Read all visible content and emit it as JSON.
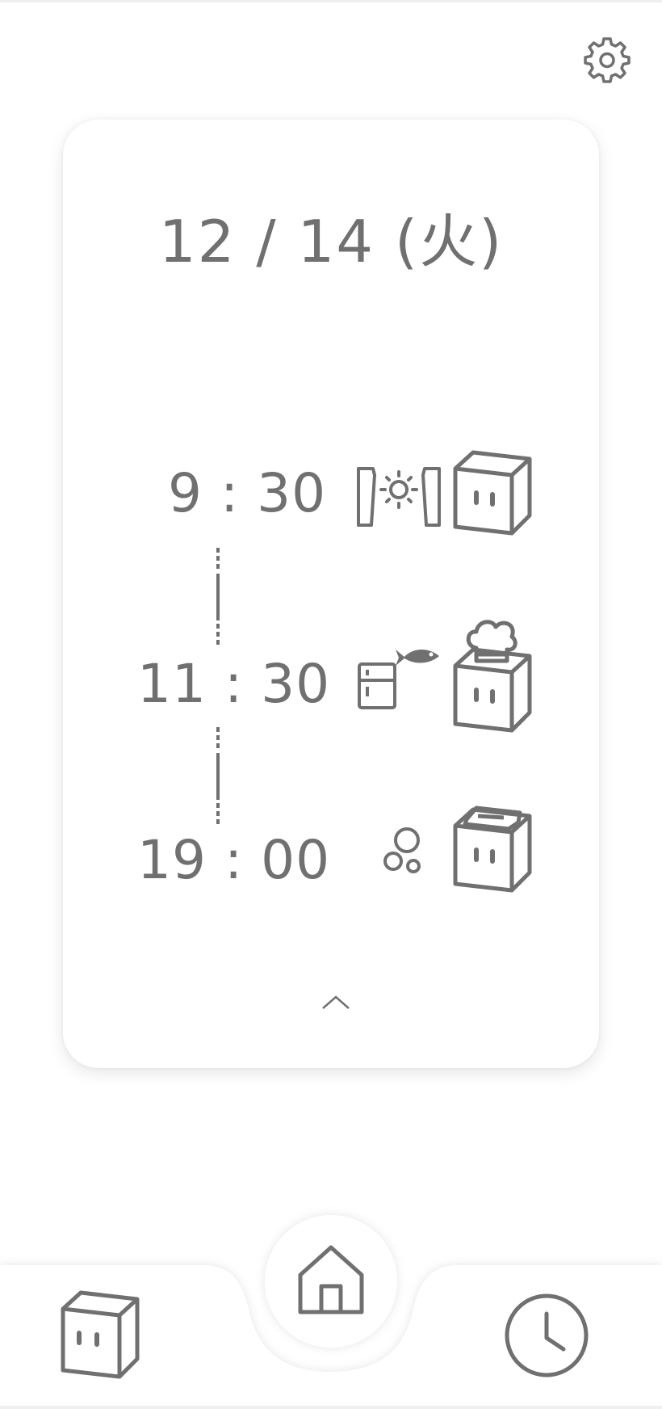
{
  "header": {
    "settings_icon": "gear-icon"
  },
  "card": {
    "date": "12 / 14 (火)",
    "schedule": [
      {
        "time": "9 : 30",
        "icon": "curtain-sun-icon",
        "avatar": "cube-character-icon"
      },
      {
        "time": "11 : 30",
        "icon": "fridge-fish-icon",
        "avatar": "cube-chef-hat-icon"
      },
      {
        "time": "19 : 00",
        "icon": "bubbles-icon",
        "avatar": "cube-lid-icon"
      }
    ],
    "expand_icon": "chevron-up-icon"
  },
  "nav": {
    "left_icon": "cube-character-icon",
    "center_icon": "home-icon",
    "right_icon": "clock-icon"
  },
  "colors": {
    "icon": "#707070",
    "background": "#ffffff",
    "card": "#ffffff"
  }
}
